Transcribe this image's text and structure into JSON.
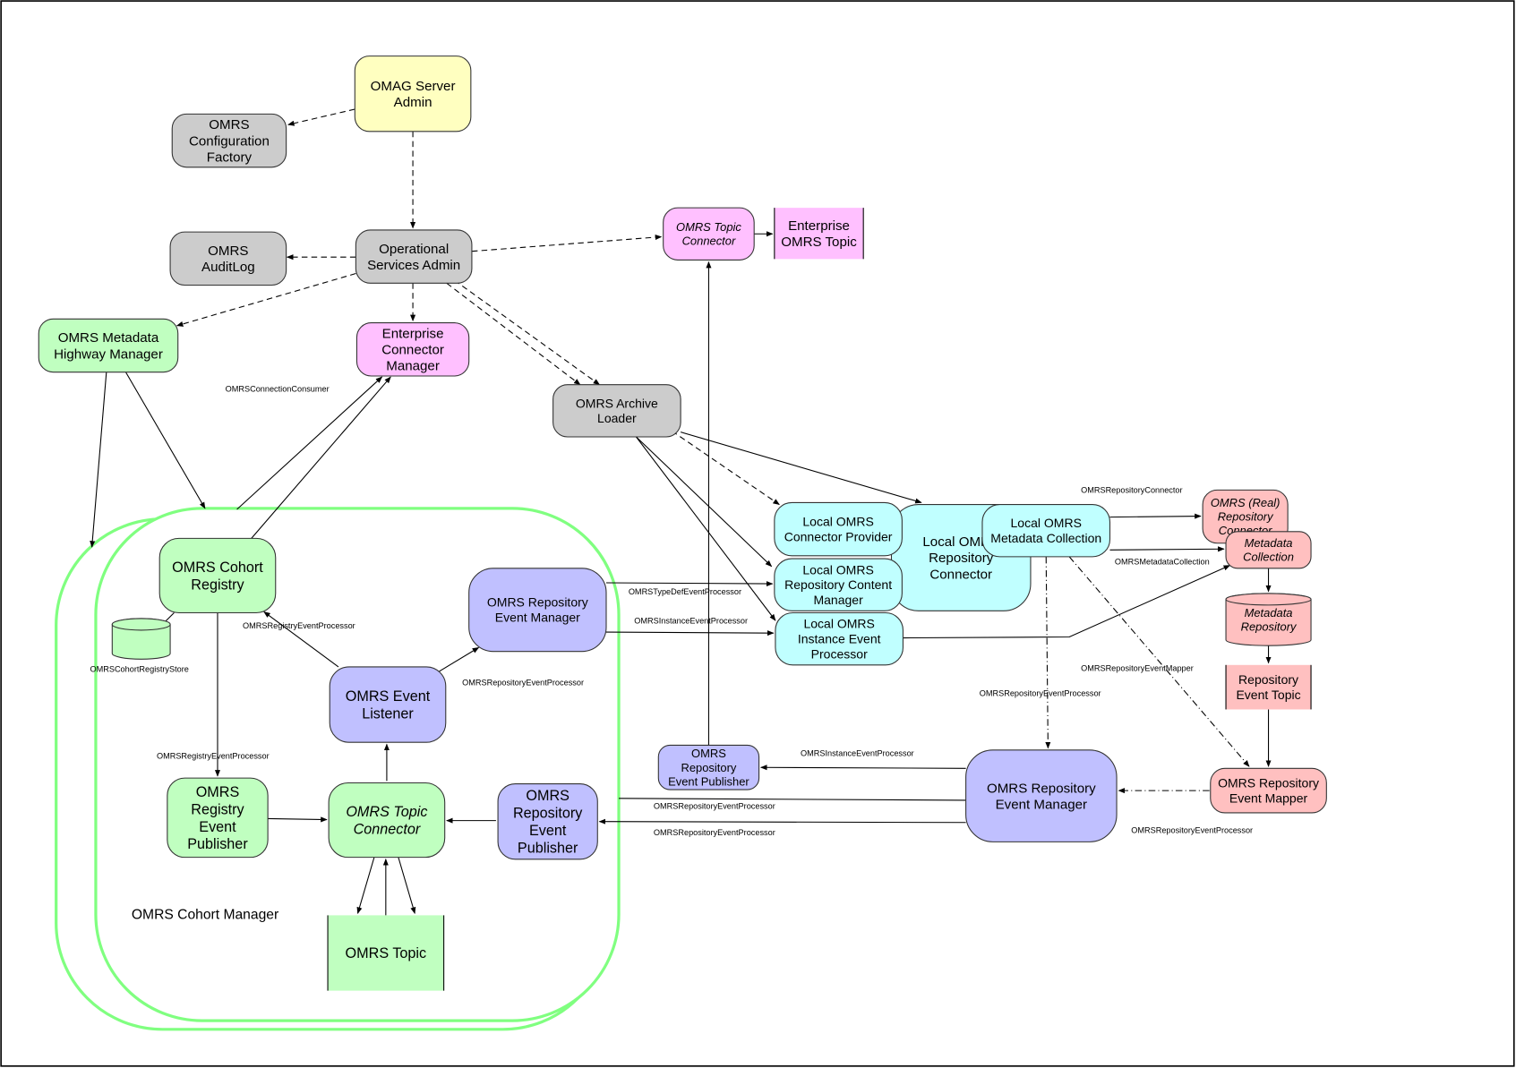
{
  "diagram": {
    "container_label": "OMRS Cohort Manager",
    "colors": {
      "yellow": "#ffffc0",
      "gray": "#cccccc",
      "green": "#c0ffc0",
      "pink": "#ffc0ff",
      "cyan": "#c0ffff",
      "salmon": "#ffc0c0",
      "purple": "#c0c0ff",
      "cohort_outline": "#80ff80"
    },
    "nodes": [
      {
        "id": "omag-server-admin",
        "label": "OMAG Server\nAdmin",
        "color": "yellow"
      },
      {
        "id": "omrs-configuration-factory",
        "label": "OMRS\nConfiguration\nFactory",
        "color": "gray"
      },
      {
        "id": "operational-services-admin",
        "label": "Operational\nServices Admin",
        "color": "gray"
      },
      {
        "id": "omrs-auditlog",
        "label": "OMRS\nAuditLog",
        "color": "gray"
      },
      {
        "id": "omrs-metadata-highway-manager",
        "label": "OMRS Metadata\nHighway Manager",
        "color": "green"
      },
      {
        "id": "enterprise-connector-manager",
        "label": "Enterprise\nConnector\nManager",
        "color": "pink"
      },
      {
        "id": "omrs-topic-connector-enterprise",
        "label": "OMRS Topic\nConnector",
        "color": "pink",
        "italic": true
      },
      {
        "id": "enterprise-omrs-topic",
        "label": "Enterprise\nOMRS Topic",
        "color": "pink",
        "shape": "topic"
      },
      {
        "id": "omrs-archive-loader",
        "label": "OMRS Archive\nLoader",
        "color": "gray"
      },
      {
        "id": "local-omrs-repository-connector",
        "label": "Local OMRS\nRepository\nConnector",
        "color": "cyan"
      },
      {
        "id": "local-omrs-connector-provider",
        "label": "Local OMRS\nConnector Provider",
        "color": "cyan"
      },
      {
        "id": "local-omrs-repository-content-manager",
        "label": "Local OMRS\nRepository Content\nManager",
        "color": "cyan"
      },
      {
        "id": "local-omrs-instance-event-processor",
        "label": "Local OMRS\nInstance Event\nProcessor",
        "color": "cyan"
      },
      {
        "id": "local-omrs-metadata-collection",
        "label": "Local OMRS\nMetadata Collection",
        "color": "cyan"
      },
      {
        "id": "omrs-real-repository-connector",
        "label": "OMRS (Real)\nRepository\nConnector",
        "color": "salmon",
        "italic": true
      },
      {
        "id": "metadata-collection",
        "label": "Metadata\nCollection",
        "color": "salmon",
        "italic": true
      },
      {
        "id": "metadata-repository",
        "label": "Metadata\nRepository",
        "color": "salmon",
        "italic": true,
        "shape": "cylinder"
      },
      {
        "id": "repository-event-topic",
        "label": "Repository\nEvent Topic",
        "color": "salmon",
        "shape": "topic"
      },
      {
        "id": "omrs-repository-event-mapper",
        "label": "OMRS Repository\nEvent Mapper",
        "color": "salmon"
      },
      {
        "id": "omrs-repository-event-manager-local",
        "label": "OMRS Repository\nEvent Manager",
        "color": "purple"
      },
      {
        "id": "omrs-repository-event-publisher-local",
        "label": "OMRS\nRepository\nEvent Publisher",
        "color": "purple"
      },
      {
        "id": "omrs-cohort-registry",
        "label": "OMRS Cohort\nRegistry",
        "color": "green"
      },
      {
        "id": "omrs-cohort-registry-store",
        "label": "",
        "color": "green",
        "shape": "cylinder"
      },
      {
        "id": "omrs-repository-event-manager-cohort",
        "label": "OMRS Repository\nEvent Manager",
        "color": "purple"
      },
      {
        "id": "omrs-event-listener",
        "label": "OMRS Event\nListener",
        "color": "purple"
      },
      {
        "id": "omrs-registry-event-publisher",
        "label": "OMRS\nRegistry\nEvent\nPublisher",
        "color": "green"
      },
      {
        "id": "omrs-topic-connector-cohort",
        "label": "OMRS Topic\nConnector",
        "color": "green",
        "italic": true
      },
      {
        "id": "omrs-repository-event-publisher-cohort",
        "label": "OMRS\nRepository\nEvent\nPublisher",
        "color": "purple"
      },
      {
        "id": "omrs-topic",
        "label": "OMRS Topic",
        "color": "green",
        "shape": "topic"
      }
    ],
    "edge_labels": [
      {
        "id": "connection-consumer",
        "text": "OMRSConnectionConsumer"
      },
      {
        "id": "cohort-registry-store",
        "text": "OMRSCohortRegistryStore"
      },
      {
        "id": "registry-event-processor-1",
        "text": "OMRSRegistryEventProcessor"
      },
      {
        "id": "registry-event-processor-2",
        "text": "OMRSRegistryEventProcessor"
      },
      {
        "id": "repository-event-processor-1",
        "text": "OMRSRepositoryEventProcessor"
      },
      {
        "id": "typedef-event-processor",
        "text": "OMRSTypeDefEventProcessor"
      },
      {
        "id": "instance-event-processor-1",
        "text": "OMRSInstanceEventProcessor"
      },
      {
        "id": "instance-event-processor-2",
        "text": "OMRSInstanceEventProcessor"
      },
      {
        "id": "repository-event-processor-2",
        "text": "OMRSRepositoryEventProcessor"
      },
      {
        "id": "repository-event-processor-3",
        "text": "OMRSRepositoryEventProcessor"
      },
      {
        "id": "repository-event-processor-4",
        "text": "OMRSRepositoryEventProcessor"
      },
      {
        "id": "repository-event-processor-5",
        "text": "OMRSRepositoryEventProcessor"
      },
      {
        "id": "repository-connector",
        "text": "OMRSRepositoryConnector"
      },
      {
        "id": "metadata-collection-label",
        "text": "OMRSMetadataCollection"
      },
      {
        "id": "repository-event-mapper",
        "text": "OMRSRepositoryEventMapper"
      }
    ]
  }
}
